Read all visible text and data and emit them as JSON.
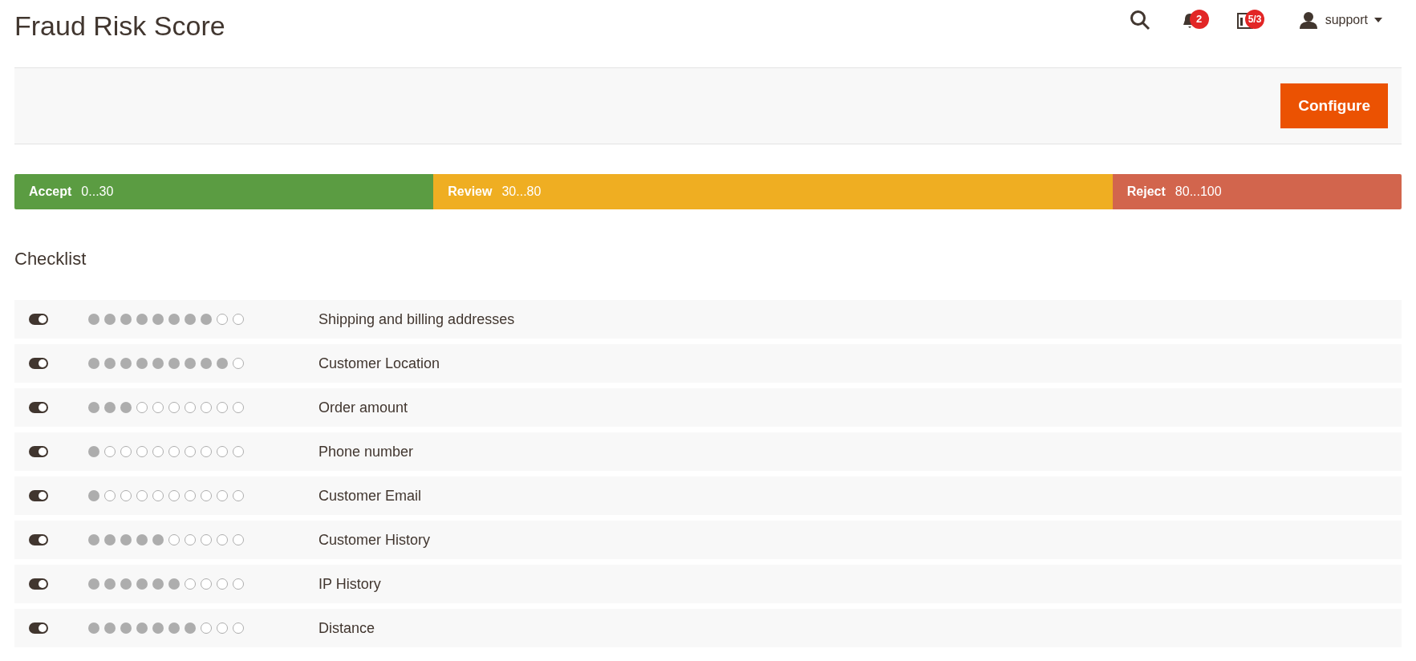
{
  "page_title": "Fraud Risk Score",
  "header": {
    "notifications_count": "2",
    "system_messages_count": "5/3",
    "user": "support"
  },
  "actions": {
    "configure_button": "Configure"
  },
  "score_ranges": [
    {
      "label": "Accept",
      "range": "0...30",
      "color": "#5b9c42"
    },
    {
      "label": "Review",
      "range": "30...80",
      "color": "#efae22"
    },
    {
      "label": "Reject",
      "range": "80...100",
      "color": "#d2654d"
    }
  ],
  "checklist": {
    "title": "Checklist",
    "items": [
      {
        "on": true,
        "stars": 8,
        "name": "Shipping and billing addresses"
      },
      {
        "on": true,
        "stars": 9,
        "name": "Customer Location"
      },
      {
        "on": true,
        "stars": 3,
        "name": "Order amount"
      },
      {
        "on": true,
        "stars": 1,
        "name": "Phone number"
      },
      {
        "on": true,
        "stars": 1,
        "name": "Customer Email"
      },
      {
        "on": true,
        "stars": 5,
        "name": "Customer History"
      },
      {
        "on": true,
        "stars": 6,
        "name": "IP History"
      },
      {
        "on": true,
        "stars": 7,
        "name": "Distance"
      }
    ]
  }
}
